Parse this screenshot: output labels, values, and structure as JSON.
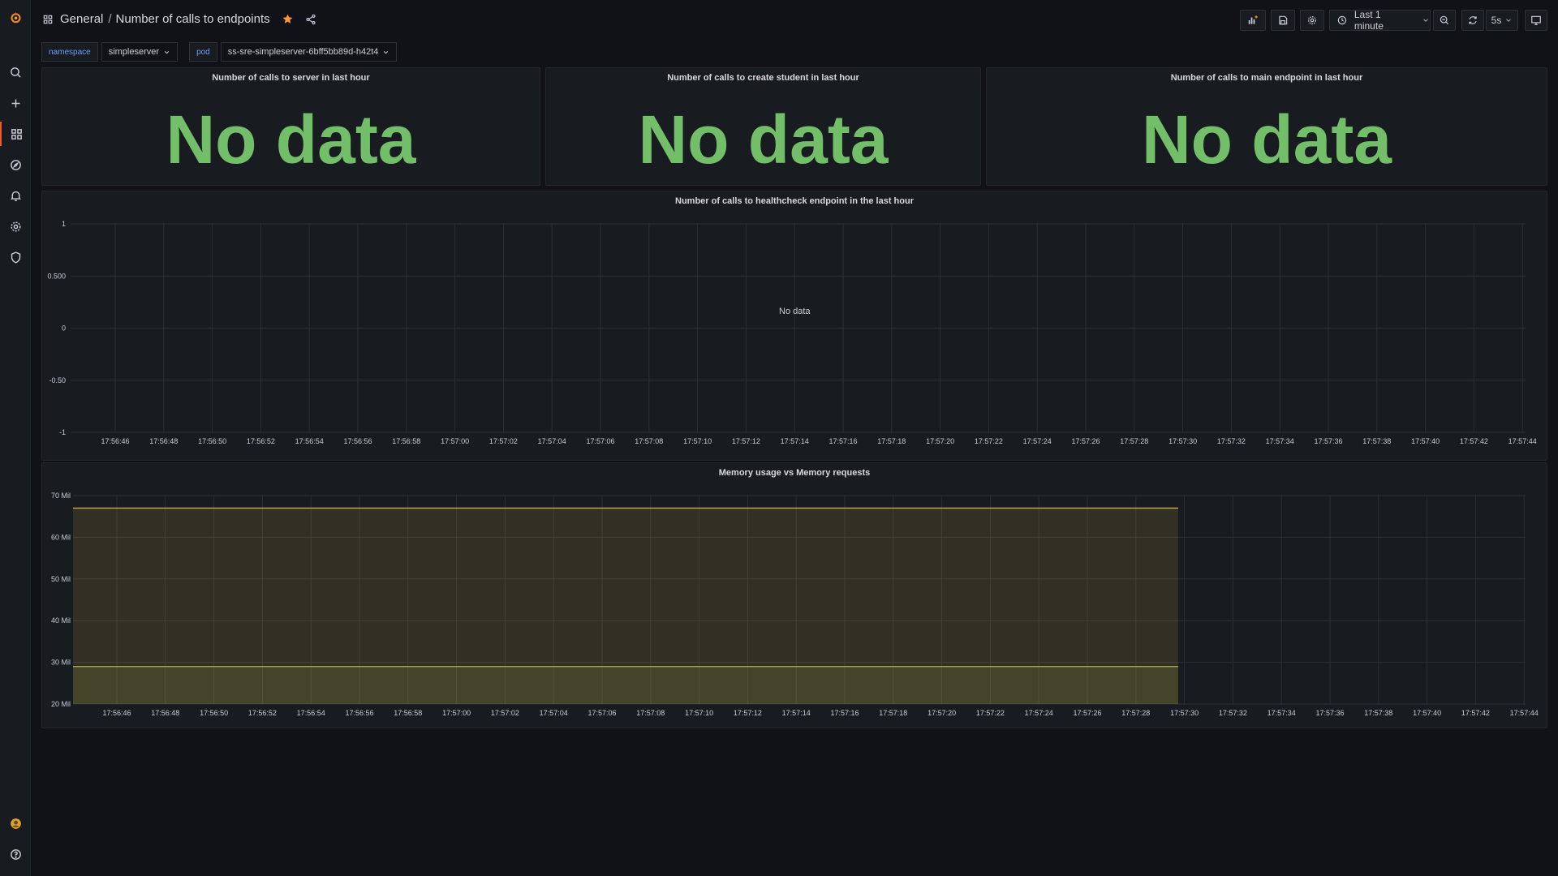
{
  "header": {
    "folder": "General",
    "separator": "/",
    "dashboard_title": "Number of calls to endpoints",
    "time_range": "Last 1 minute",
    "refresh_interval": "5s"
  },
  "variables": [
    {
      "label": "namespace",
      "value": "simpleserver"
    },
    {
      "label": "pod",
      "value": "ss-sre-simpleserver-6bff5bb89d-h42t4"
    }
  ],
  "stat_panels": [
    {
      "title": "Number of calls to server in last hour",
      "value": "No data"
    },
    {
      "title": "Number of calls to create student in last hour",
      "value": "No data"
    },
    {
      "title": "Number of calls to main endpoint in last hour",
      "value": "No data"
    }
  ],
  "colors": {
    "accent": "#f05a28",
    "stat_green": "#73bf69",
    "series_yellow": "#c9a94a",
    "series_green_yellow": "#a7b94c",
    "star": "#ff9830"
  },
  "icons": {
    "sidebar": [
      "grafana-logo-icon",
      "search-icon",
      "plus-icon",
      "dashboards-icon",
      "explore-icon",
      "alerting-icon",
      "settings-icon",
      "shield-icon",
      "avatar-icon",
      "help-icon"
    ],
    "toolbar": [
      "add-panel-icon",
      "save-icon",
      "gear-icon",
      "clock-icon",
      "zoom-out-icon",
      "refresh-icon",
      "tv-icon"
    ]
  },
  "chart_data": [
    {
      "type": "line",
      "title": "Number of calls to healthcheck endpoint in the last hour",
      "no_data_text": "No data",
      "ylim": [
        -1,
        1
      ],
      "y_ticks": [
        "1",
        "0.500",
        "0",
        "-0.50",
        "-1"
      ],
      "x_ticks": [
        "17:56:46",
        "17:56:48",
        "17:56:50",
        "17:56:52",
        "17:56:54",
        "17:56:56",
        "17:56:58",
        "17:57:00",
        "17:57:02",
        "17:57:04",
        "17:57:06",
        "17:57:08",
        "17:57:10",
        "17:57:12",
        "17:57:14",
        "17:57:16",
        "17:57:18",
        "17:57:20",
        "17:57:22",
        "17:57:24",
        "17:57:26",
        "17:57:28",
        "17:57:30",
        "17:57:32",
        "17:57:34",
        "17:57:36",
        "17:57:38",
        "17:57:40",
        "17:57:42",
        "17:57:44"
      ],
      "series": [],
      "grid": true
    },
    {
      "type": "area",
      "title": "Memory usage vs Memory requests",
      "ylim": [
        20,
        70
      ],
      "y_ticks": [
        "70 Mil",
        "60 Mil",
        "50 Mil",
        "40 Mil",
        "30 Mil",
        "20 Mil"
      ],
      "x_ticks": [
        "17:56:46",
        "17:56:48",
        "17:56:50",
        "17:56:52",
        "17:56:54",
        "17:56:56",
        "17:56:58",
        "17:57:00",
        "17:57:02",
        "17:57:04",
        "17:57:06",
        "17:57:08",
        "17:57:10",
        "17:57:12",
        "17:57:14",
        "17:57:16",
        "17:57:18",
        "17:57:20",
        "17:57:22",
        "17:57:24",
        "17:57:26",
        "17:57:28",
        "17:57:30",
        "17:57:32",
        "17:57:34",
        "17:57:36",
        "17:57:38",
        "17:57:40",
        "17:57:42",
        "17:57:44"
      ],
      "x_range_seconds": [
        -1,
        58.8
      ],
      "series": [
        {
          "color": "#c9a94a",
          "x": [
            -1,
            44.5
          ],
          "y": [
            67,
            67
          ]
        },
        {
          "color": "#a7b94c",
          "x": [
            -1,
            44.5
          ],
          "y": [
            29,
            29
          ]
        }
      ],
      "grid": true
    }
  ]
}
